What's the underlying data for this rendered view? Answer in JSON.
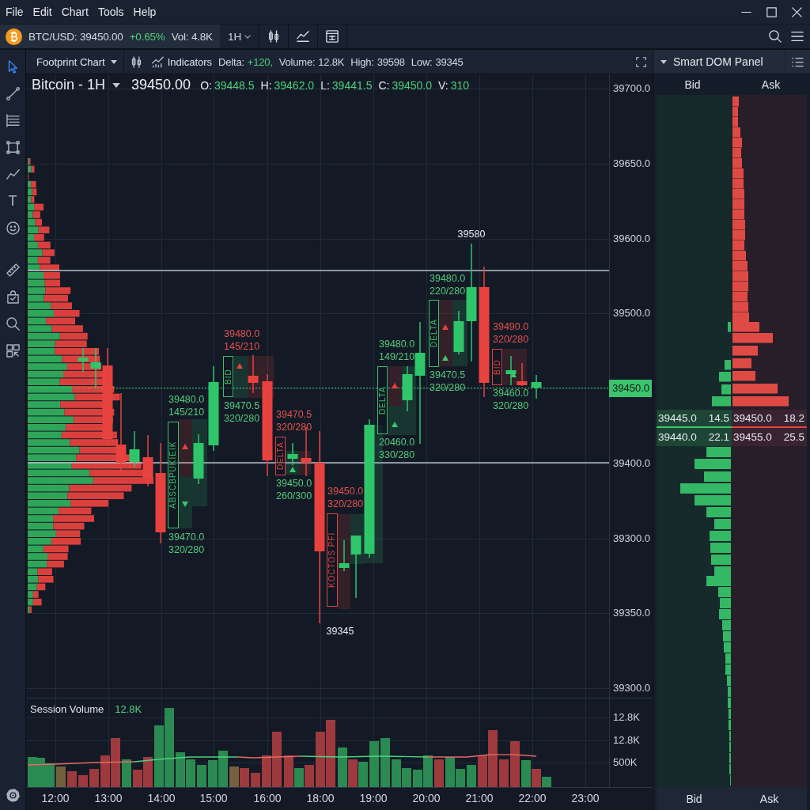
{
  "menu_bar": {
    "items": [
      "File",
      "Edit",
      "Chart",
      "Tools",
      "Help"
    ]
  },
  "toolbar": {
    "symbol": "BTC/USD: 39450.00",
    "change": "+0.65%",
    "volume": "Vol: 4.8K",
    "interval": "1H"
  },
  "tools": [
    {
      "kind": "cursor",
      "selected": true
    },
    {
      "kind": "line",
      "selected": false
    },
    {
      "kind": "lines",
      "selected": false
    },
    {
      "kind": "rectangle",
      "selected": false
    },
    {
      "kind": "path",
      "selected": false
    },
    {
      "kind": "text",
      "glyph": "T",
      "selected": false
    },
    {
      "kind": "emoji",
      "selected": false
    },
    {
      "kind": "ruler",
      "selected": false
    },
    {
      "kind": "bag",
      "selected": false
    },
    {
      "kind": "zoom",
      "selected": false
    },
    {
      "kind": "layout",
      "selected": false
    }
  ],
  "chart_header": {
    "chart_type": "Footprint Chart",
    "indicators": "Indicators",
    "stats": [
      {
        "label": "Delta:",
        "value": "+120,",
        "kind": "positive"
      },
      {
        "label": "Volume:",
        "value": "12.8K",
        "kind": "neutral"
      },
      {
        "label": "High:",
        "value": "39598",
        "kind": "neutral"
      },
      {
        "label": "Low:",
        "value": "39345",
        "kind": "neutral"
      }
    ]
  },
  "legend": {
    "title": "Bitcoin - 1H",
    "price": "39450.00",
    "values": [
      {
        "label": "O:",
        "value": "39448.5"
      },
      {
        "label": "H:",
        "value": "39462.0"
      },
      {
        "label": "L:",
        "value": "39441.5"
      },
      {
        "label": "C:",
        "value": "39450.0"
      },
      {
        "label": "V:",
        "value": "310"
      }
    ]
  },
  "price_axis": [
    {
      "text": "39700.0",
      "current": false
    },
    {
      "text": "39650.0",
      "current": false
    },
    {
      "text": "39600.0",
      "current": false
    },
    {
      "text": "39500.0",
      "current": false
    },
    {
      "text": "39450.0",
      "current": true
    },
    {
      "text": "39400.0",
      "current": false
    },
    {
      "text": "39300.0",
      "current": false
    },
    {
      "text": "39350.0",
      "current": false
    },
    {
      "text": "39300.0",
      "current": false
    }
  ],
  "price_marks": [
    {
      "text": "39580"
    },
    {
      "text": "39345"
    }
  ],
  "footprint_labels": [
    {
      "price": "39480.0",
      "volume": "145/210",
      "color": "#56c97a"
    },
    {
      "price": "39470.0",
      "volume": "320/280",
      "color": "#56c97a"
    },
    {
      "price": "39480.0",
      "volume": "145/210",
      "color": "#e5504b"
    },
    {
      "price": "39470.5",
      "volume": "320/280",
      "color": "#56c97a"
    },
    {
      "price": "39470.5",
      "volume": "320/280",
      "color": "#e5504b"
    },
    {
      "price": "39450.0",
      "volume": "260/300",
      "color": "#56c97a"
    },
    {
      "price": "39450.0",
      "volume": "320/280",
      "color": "#e5504b"
    },
    {
      "price": "39480.0",
      "volume": "149/210",
      "color": "#56c97a"
    },
    {
      "price": "20460.0",
      "volume": "330/280",
      "color": "#56c97a"
    },
    {
      "price": "39480.0",
      "volume": "220/280",
      "color": "#56c97a"
    },
    {
      "price": "39470.5",
      "volume": "320/280",
      "color": "#56c97a"
    },
    {
      "price": "39490.0",
      "volume": "320/280",
      "color": "#e5504b"
    },
    {
      "price": "39460.0",
      "volume": "320/280",
      "color": "#56c97a"
    }
  ],
  "footprint_tags": [
    {
      "text": "ABSCBPUKIEIK",
      "color": "#3bbf68"
    },
    {
      "text": "BID",
      "color": "#3bbf68"
    },
    {
      "text": "DELTA",
      "color": "#d9453f"
    },
    {
      "text": "KOCTOS PFI",
      "color": "#d9453f"
    },
    {
      "text": "DELTA",
      "color": "#3bbf68"
    },
    {
      "text": "DELTA",
      "color": "#3bbf68"
    },
    {
      "text": "BID",
      "color": "#d9453f"
    }
  ],
  "volume_pane": {
    "title": "Session Volume",
    "value": "12.8K",
    "axis_labels": [
      "12.8K",
      "12.8K",
      "500K"
    ]
  },
  "time_axis": [
    "12:00",
    "13:00",
    "14:00",
    "15:00",
    "16:00",
    "18:00",
    "19:00",
    "20:00",
    "21:00",
    "22:00",
    "23:00"
  ],
  "dom_panel": {
    "title": "Smart DOM Panel",
    "columns": [
      "Bid",
      "Ask"
    ],
    "quotes": [
      {
        "bid_price": "39445.0",
        "bid_size": "14.5",
        "ask_price": "39450.0",
        "ask_size": "18.2"
      },
      {
        "bid_price": "39440.0",
        "bid_size": "22.1",
        "ask_price": "39455.0",
        "ask_size": "25.5"
      }
    ],
    "footer": [
      "Bid",
      "Ask"
    ]
  }
}
